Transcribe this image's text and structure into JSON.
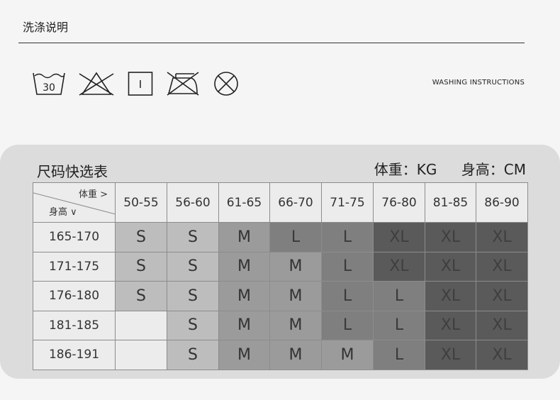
{
  "wash": {
    "title": "洗涤说明",
    "subtitle": "WASHING INSTRUCTIONS",
    "icons": [
      {
        "name": "wash-30-icon",
        "label": "30"
      },
      {
        "name": "no-bleach-icon"
      },
      {
        "name": "tumble-dry-low-icon",
        "label": "I"
      },
      {
        "name": "no-iron-icon"
      },
      {
        "name": "no-dry-clean-icon"
      }
    ]
  },
  "chart": {
    "title": "尺码快选表",
    "weight_unit": "体重：KG",
    "height_unit": "身高：CM",
    "corner_top": "体重 >",
    "corner_bottom": "身高 ∨",
    "columns": [
      "50-55",
      "56-60",
      "61-65",
      "66-70",
      "71-75",
      "76-80",
      "81-85",
      "86-90"
    ],
    "rows": [
      {
        "label": "165-170",
        "cells": [
          "S",
          "S",
          "M",
          "L",
          "L",
          "XL",
          "XL",
          "XL"
        ]
      },
      {
        "label": "171-175",
        "cells": [
          "S",
          "S",
          "M",
          "M",
          "L",
          "XL",
          "XL",
          "XL"
        ]
      },
      {
        "label": "176-180",
        "cells": [
          "S",
          "S",
          "M",
          "M",
          "L",
          "L",
          "XL",
          "XL"
        ]
      },
      {
        "label": "181-185",
        "cells": [
          "",
          "S",
          "M",
          "M",
          "L",
          "L",
          "XL",
          "XL"
        ]
      },
      {
        "label": "186-191",
        "cells": [
          "",
          "S",
          "M",
          "M",
          "M",
          "L",
          "XL",
          "XL"
        ]
      }
    ],
    "size_colors": {
      "": "#ececec",
      "S": "#bdbdbd",
      "M": "#9b9b9b",
      "L": "#7f7f7f",
      "XL": "#5a5a5a"
    },
    "size_text_colors": {
      "": "#333333",
      "S": "#333333",
      "M": "#333333",
      "L": "#3a3a3a",
      "XL": "#3f3f3f"
    }
  }
}
